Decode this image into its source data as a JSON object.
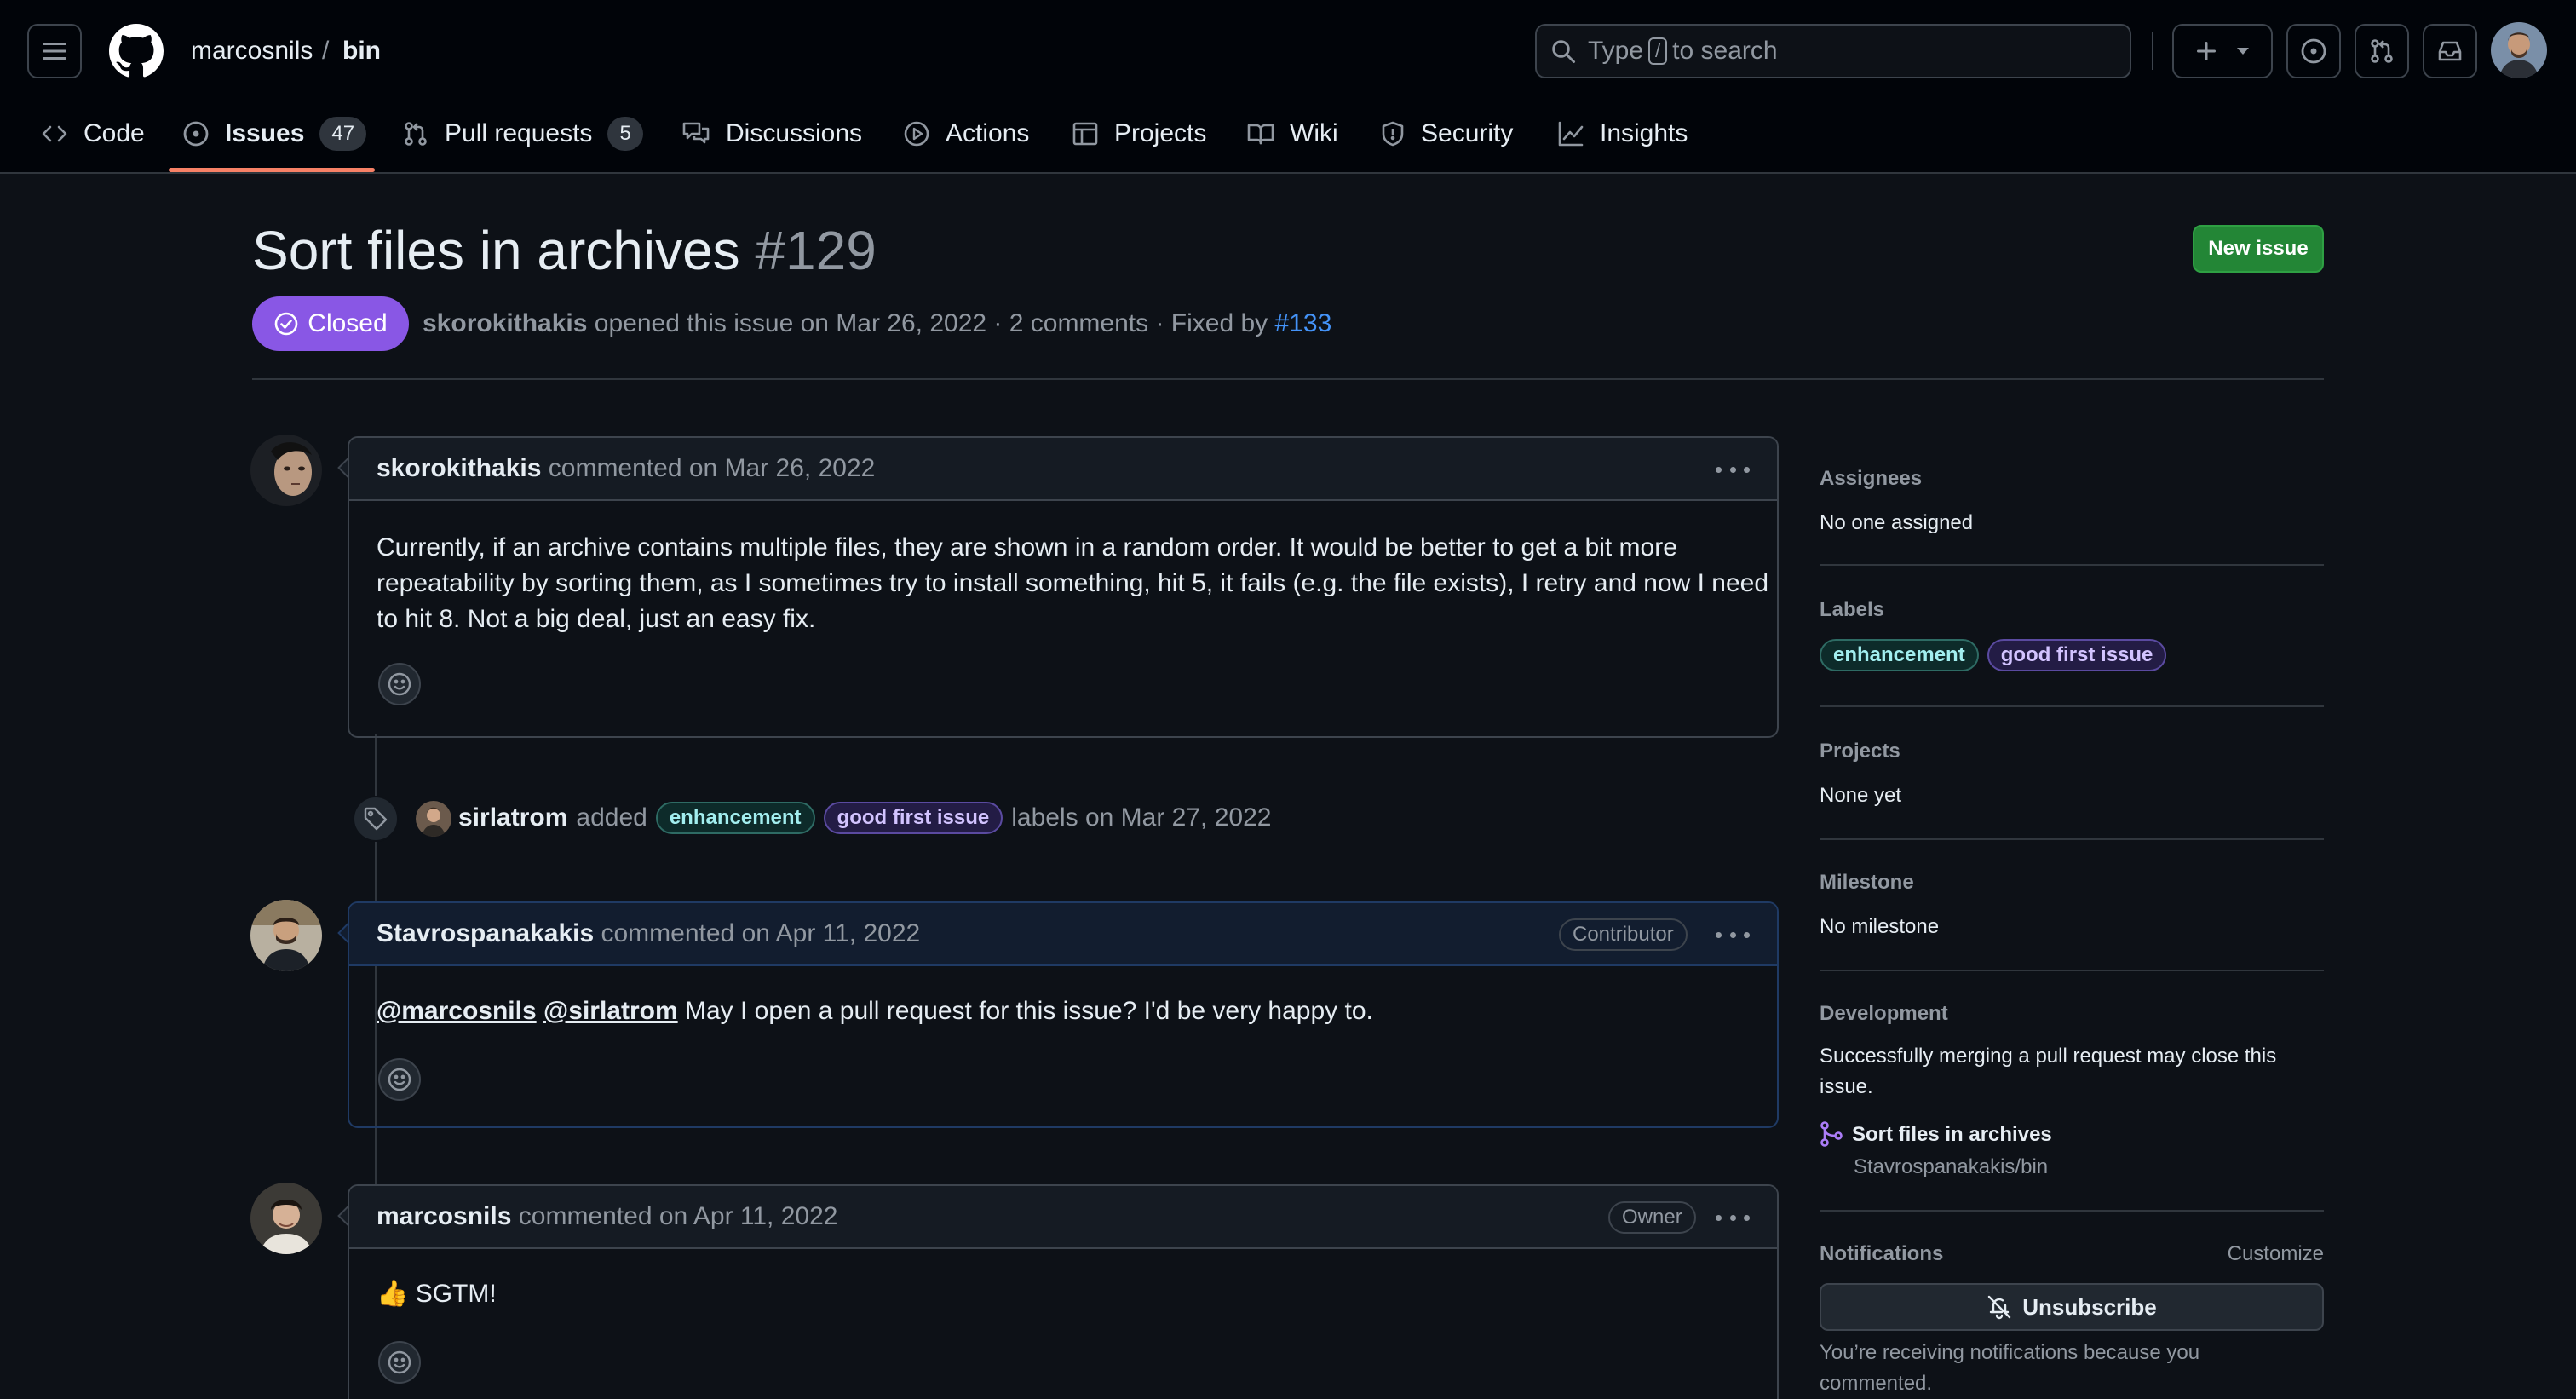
{
  "header": {
    "owner": "marcosnils",
    "separator": "/",
    "repo": "bin",
    "search_prefix": "Type",
    "search_key": "/",
    "search_suffix": "to search"
  },
  "tabs": [
    {
      "label": "Code"
    },
    {
      "label": "Issues",
      "count": "47"
    },
    {
      "label": "Pull requests",
      "count": "5"
    },
    {
      "label": "Discussions"
    },
    {
      "label": "Actions"
    },
    {
      "label": "Projects"
    },
    {
      "label": "Wiki"
    },
    {
      "label": "Security"
    },
    {
      "label": "Insights"
    }
  ],
  "issue": {
    "title": "Sort files in archives",
    "number": "#129",
    "state": "Closed",
    "author": "skorokithakis",
    "opened_text": "opened this issue on Mar 26, 2022 · 2 comments · Fixed by",
    "fixed_by": "#133",
    "new_issue_label": "New issue"
  },
  "comments": [
    {
      "author": "skorokithakis",
      "date": "commented on Mar 26, 2022",
      "lines": [
        "Currently, if an archive contains multiple files, they are shown in a random order. It would be better to get a bit more",
        "repeatability by sorting them, as I sometimes try to install something, hit 5, it fails (e.g. the file exists), I retry and now I need",
        "to hit 8. Not a big deal, just an easy fix."
      ]
    },
    {
      "author": "Stavrospanakakis",
      "date": "commented on Apr 11, 2022",
      "role": "Contributor",
      "mention1": "@marcosnils",
      "mention2": "@sirlatrom",
      "text": "May I open a pull request for this issue? I'd be very happy to."
    },
    {
      "author": "marcosnils",
      "date": "commented on Apr 11, 2022",
      "role": "Owner",
      "emoji": "👍",
      "text": "SGTM!"
    }
  ],
  "event": {
    "actor": "sirlatrom",
    "action": "added",
    "label1": "enhancement",
    "label2": "good first issue",
    "suffix": "labels on Mar 27, 2022"
  },
  "sidebar": {
    "assignees_title": "Assignees",
    "assignees_value": "No one assigned",
    "labels_title": "Labels",
    "labels": [
      "enhancement",
      "good first issue"
    ],
    "projects_title": "Projects",
    "projects_value": "None yet",
    "milestone_title": "Milestone",
    "milestone_value": "No milestone",
    "development_title": "Development",
    "development_line1": "Successfully merging a pull request may close this",
    "development_line2": "issue.",
    "pr_title": "Sort files in archives",
    "pr_repo": "Stavrospanakakis/bin",
    "notifications_title": "Notifications",
    "customize": "Customize",
    "unsubscribe": "Unsubscribe",
    "notif_line1": "You’re receiving notifications because you",
    "notif_line2": "commented."
  },
  "colors": {
    "accent_tab": "#f78166",
    "closed": "#8957e5",
    "new_issue": "#238636",
    "link": "#4493f8"
  }
}
